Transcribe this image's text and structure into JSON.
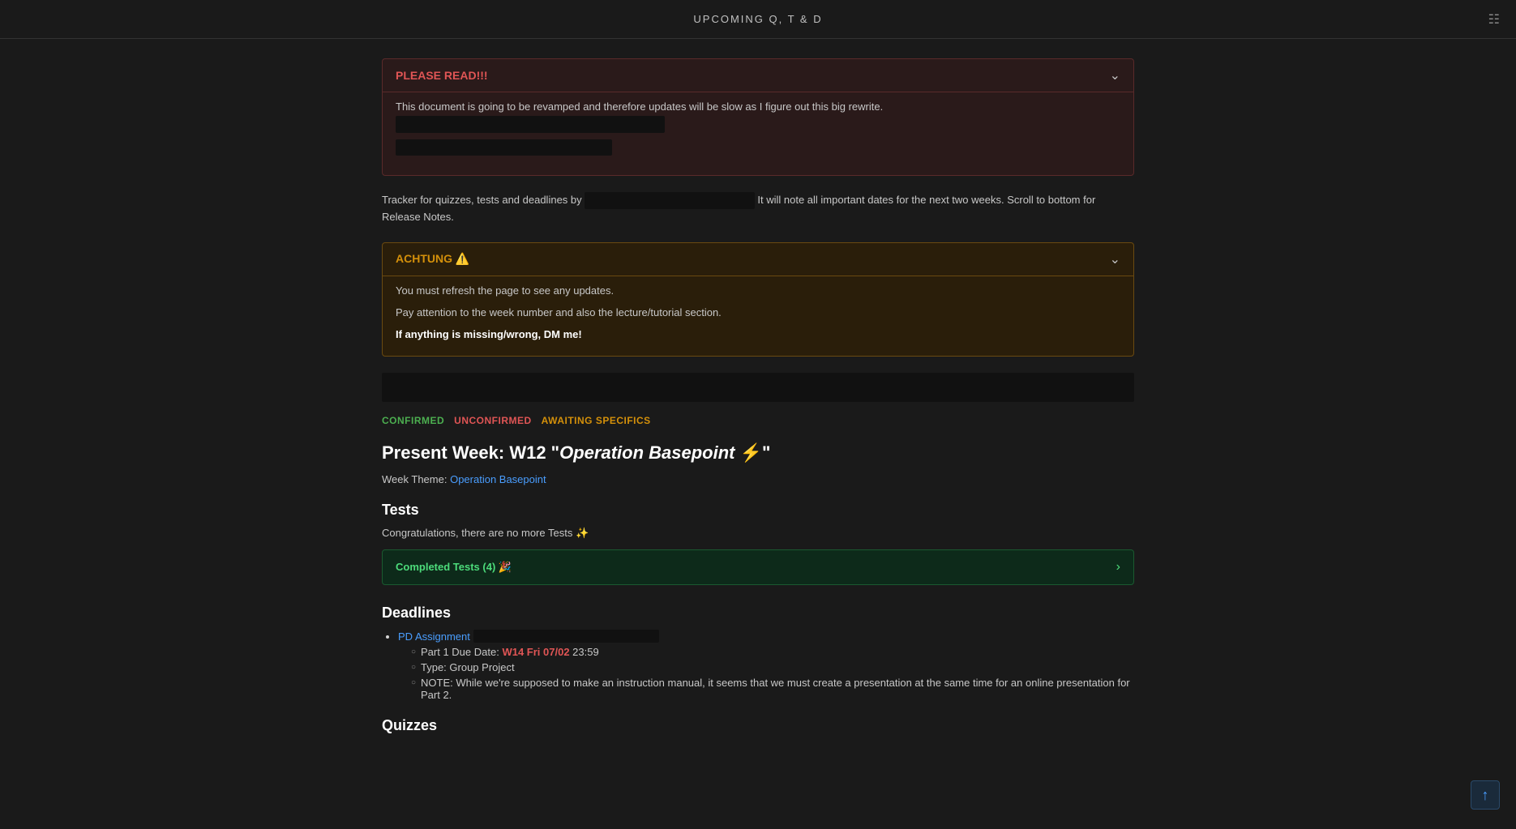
{
  "topbar": {
    "title": "UPCOMING Q, T & D",
    "icon": "document-icon"
  },
  "please_read_banner": {
    "title": "PLEASE READ!!!",
    "body_text": "This document is going to be revamped and therefore updates will be slow as I figure out this big rewrite.",
    "redacted_1": "████████████████████████████████████",
    "redacted_2": "████████████████████"
  },
  "tracker_text": {
    "prefix": "Tracker for quizzes, tests and deadlines by",
    "redacted": "████████████████████████",
    "suffix": "It will note all important dates for the next two weeks. Scroll to bottom for Release Notes."
  },
  "achtung_banner": {
    "title": "ACHTUNG",
    "warning_icon": "⚠️",
    "line1": "You must refresh the page to see any updates.",
    "line2": "Pay attention to the week number and also the lecture/tutorial section.",
    "line3": "If anything is missing/wrong, DM me!"
  },
  "legend": {
    "confirmed": "CONFIRMED",
    "unconfirmed": "UNCONFIRMED",
    "awaiting": "AWAITING SPECIFICS"
  },
  "present_week": {
    "label": "Present Week: W12 \"",
    "operation": "Operation Basepoint",
    "emoji": "⚡",
    "closing": "\""
  },
  "week_theme": {
    "prefix": "Week Theme:",
    "link_text": "Operation Basepoint",
    "link_href": "#"
  },
  "tests_section": {
    "heading": "Tests",
    "no_tests_text": "Congratulations, there are no more Tests ✨",
    "completed_tests_label": "Completed Tests (4) 🎉",
    "chevron": "›"
  },
  "deadlines_section": {
    "heading": "Deadlines",
    "items": [
      {
        "link_text": "PD Assignment",
        "sub_items": [
          {
            "text": "Part 1 Due Date: ",
            "date": "W14 Fri 07/02",
            "time": " 23:59"
          },
          {
            "text": "Type: Group Project"
          },
          {
            "text": "NOTE: While we're supposed to make an instruction manual, it seems that we must create a presentation at the same time for an online presentation for Part 2."
          }
        ]
      }
    ]
  },
  "quizzes_section": {
    "heading": "Quizzes"
  },
  "scroll_top": {
    "icon": "arrow-up-icon",
    "symbol": "↑"
  }
}
